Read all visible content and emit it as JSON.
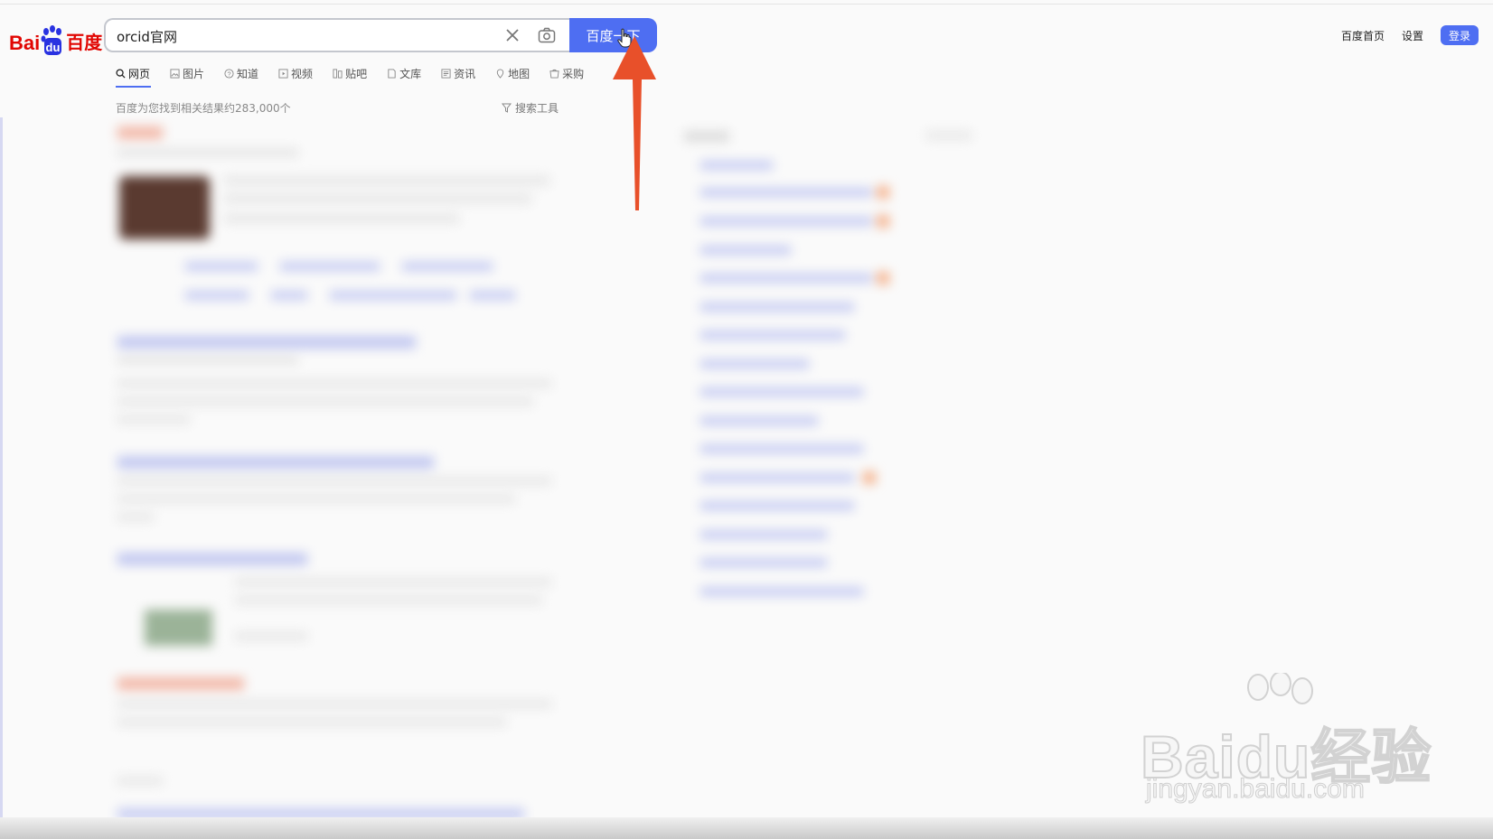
{
  "logo": {
    "part1": "Bai",
    "part2": "du",
    "part3": "百度"
  },
  "search": {
    "query": "orcid官网",
    "button_label": "百度一下"
  },
  "top_nav": {
    "home": "百度首页",
    "settings": "设置",
    "login": "登录"
  },
  "tabs": [
    {
      "label": "网页",
      "icon": "search-icon"
    },
    {
      "label": "图片",
      "icon": "image-icon"
    },
    {
      "label": "知道",
      "icon": "question-icon"
    },
    {
      "label": "视频",
      "icon": "video-icon"
    },
    {
      "label": "贴吧",
      "icon": "tieba-icon"
    },
    {
      "label": "文库",
      "icon": "document-icon"
    },
    {
      "label": "资讯",
      "icon": "news-icon"
    },
    {
      "label": "地图",
      "icon": "map-icon"
    },
    {
      "label": "采购",
      "icon": "purchase-icon"
    }
  ],
  "results_info": {
    "count_text": "百度为您找到相关结果约283,000个",
    "tools_label": "搜索工具"
  },
  "watermark": {
    "brand": "Baidu经验",
    "url": "jingyan.baidu.com"
  },
  "colors": {
    "brand_blue": "#4e6ef2",
    "logo_red": "#e10602",
    "logo_blue": "#2932e1",
    "arrow": "#e8502a"
  }
}
